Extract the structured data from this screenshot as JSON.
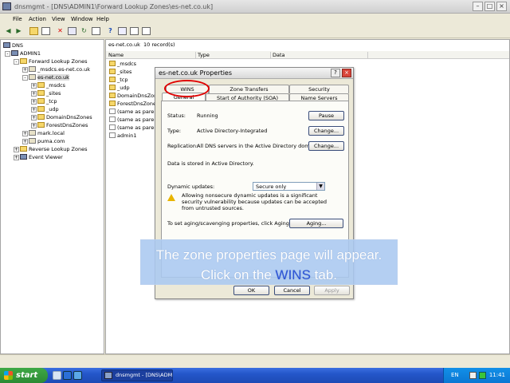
{
  "window": {
    "title": "dnsmgmt - [DNS\\ADMIN1\\Forward Lookup Zones\\es-net.co.uk]"
  },
  "menu": [
    "File",
    "Action",
    "View",
    "Window",
    "Help"
  ],
  "tree": {
    "root": "DNS",
    "server": "ADMIN1",
    "flz": "Forward Lookup Zones",
    "zones": [
      "_msdcs.es-net.co.uk",
      "es-net.co.uk"
    ],
    "sub": [
      "_msdcs",
      "_sites",
      "_tcp",
      "_udp",
      "DomainDnsZones",
      "ForestDnsZones"
    ],
    "more": [
      "mark.local",
      "puma.com"
    ],
    "rlz": "Reverse Lookup Zones",
    "ev": "Event Viewer"
  },
  "right": {
    "zone": "es-net.co.uk",
    "count": "10 record(s)",
    "columns": [
      "Name",
      "Type",
      "Data"
    ],
    "rows": [
      "_msdcs",
      "_sites",
      "_tcp",
      "_udp",
      "DomainDnsZones",
      "ForestDnsZones",
      "(same as parent",
      "(same as parent",
      "(same as parent",
      "admin1"
    ]
  },
  "dialog": {
    "title": "es-net.co.uk Properties",
    "help": "?",
    "close": "×",
    "tabs_top": [
      "WINS",
      "Zone Transfers",
      "Security"
    ],
    "tabs_bottom": [
      "General",
      "Start of Authority (SOA)",
      "Name Servers"
    ],
    "status_label": "Status:",
    "status_value": "Running",
    "pause": "Pause",
    "type_label": "Type:",
    "type_value": "Active Directory-Integrated",
    "change": "Change...",
    "replication_label": "Replication:",
    "replication_value": "All DNS servers in the Active Directory domain",
    "stored": "Data is stored in Active Directory.",
    "dyn_label": "Dynamic updates:",
    "dyn_value": "Secure only",
    "warning": "Allowing nonsecure dynamic updates is a significant security vulnerability because updates can be accepted from untrusted sources.",
    "aging_text": "To set aging/scavenging properties, click Aging.",
    "aging": "Aging...",
    "ok": "OK",
    "cancel": "Cancel",
    "apply": "Apply"
  },
  "banner": {
    "part1": "The zone properties page will appear. Click on the ",
    "highlight": "WINS",
    "part2": " tab."
  },
  "taskbar": {
    "start": "start",
    "task": "dnsmgmt - [DNS\\ADM...",
    "lang": "EN",
    "clock": "11:41"
  },
  "colors": {
    "highlight_ring": "#e00000",
    "banner_bg": "#aac8f0",
    "banner_highlight": "#2d55d8"
  }
}
